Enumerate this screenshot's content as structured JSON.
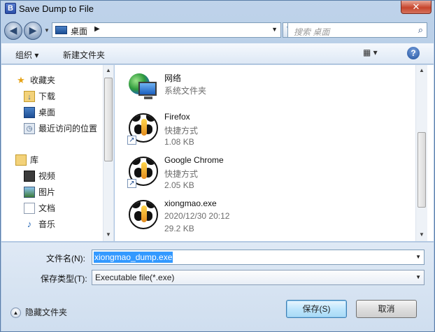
{
  "window": {
    "title": "Save Dump to File",
    "close_label": "✕"
  },
  "address": {
    "location": "桌面",
    "separator": "▶"
  },
  "search": {
    "placeholder": "搜索 桌面"
  },
  "toolbar": {
    "organize": "组织 ▾",
    "new_folder": "新建文件夹",
    "view": "▦ ▾",
    "help": "?"
  },
  "nav": {
    "favorites_header": "收藏夹",
    "favorites": [
      {
        "label": "下载",
        "icon": "downloads-folder-icon"
      },
      {
        "label": "桌面",
        "icon": "desktop-icon"
      },
      {
        "label": "最近访问的位置",
        "icon": "recent-places-icon"
      }
    ],
    "libraries_header": "库",
    "libraries": [
      {
        "label": "视频",
        "icon": "video-library-icon"
      },
      {
        "label": "图片",
        "icon": "pictures-library-icon"
      },
      {
        "label": "文档",
        "icon": "documents-library-icon"
      },
      {
        "label": "音乐",
        "icon": "music-library-icon"
      }
    ]
  },
  "files": [
    {
      "name": "网络",
      "line2": "系统文件夹",
      "line3": ""
    },
    {
      "name": "Firefox",
      "line2": "快捷方式",
      "line3": "1.08 KB"
    },
    {
      "name": "Google Chrome",
      "line2": "快捷方式",
      "line3": "2.05 KB"
    },
    {
      "name": "xiongmao.exe",
      "line2": "2020/12/30 20:12",
      "line3": "29.2 KB"
    }
  ],
  "form": {
    "filename_label": "文件名(N):",
    "filename_value": "xiongmao_dump.exe",
    "filetype_label": "保存类型(T):",
    "filetype_value": "Executable file(*.exe)",
    "hide_folders": "隐藏文件夹",
    "save_button": "保存(S)",
    "cancel_button": "取消"
  }
}
